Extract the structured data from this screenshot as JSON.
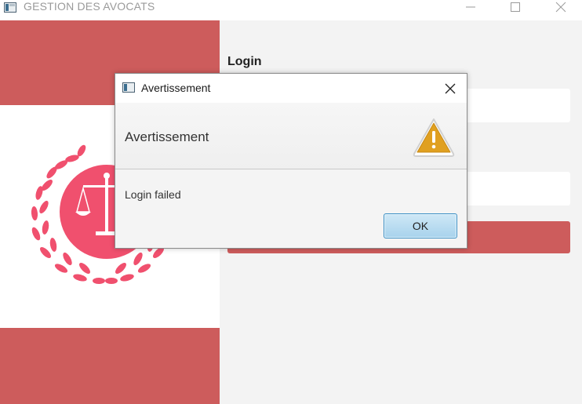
{
  "window": {
    "title": "GESTION DES AVOCATS",
    "controls": [
      "minimize-icon",
      "maximize-icon",
      "close-icon"
    ]
  },
  "login_panel": {
    "heading": "Login"
  },
  "dialog": {
    "title": "Avertissement",
    "header": "Avertissement",
    "content": "Login failed",
    "ok_label": "OK",
    "icon": "warning-icon"
  },
  "colors": {
    "accent": "#cd5c5c",
    "emblem": "#f0506e",
    "warning": "#e0a020"
  }
}
